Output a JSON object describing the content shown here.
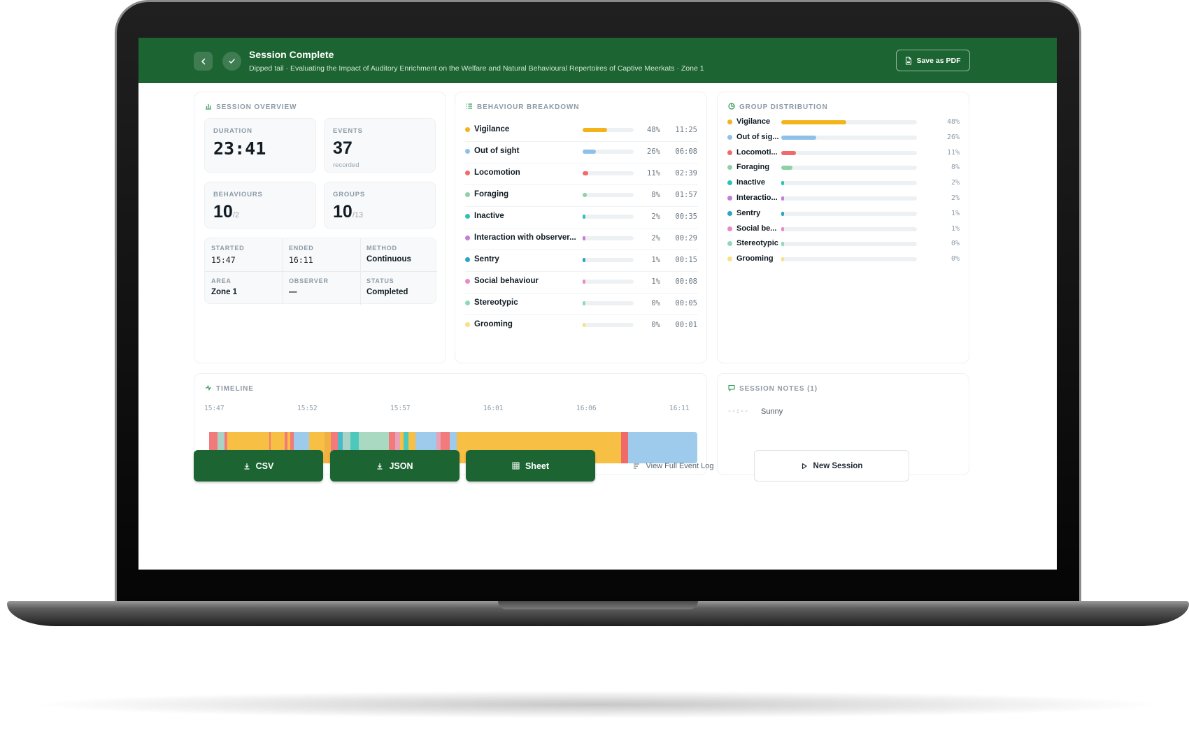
{
  "header": {
    "title": "Session Complete",
    "subtitle": "Dipped tail · Evaluating the Impact of Auditory Enrichment on the Welfare and Natural Behavioural Repertoires of Captive Meerkats · Zone 1",
    "save_pdf_label": "Save as PDF",
    "icons": {
      "back": "chevron-left-icon",
      "status": "check-icon",
      "pdf": "document-icon"
    }
  },
  "overview": {
    "title": "SESSION OVERVIEW",
    "duration": {
      "label": "DURATION",
      "value": "23:41"
    },
    "events": {
      "label": "EVENTS",
      "value": "37",
      "note": "recorded"
    },
    "behaviours": {
      "label": "BEHAVIOURS",
      "value": "10",
      "suffix": "/2"
    },
    "groups": {
      "label": "GROUPS",
      "value": "10",
      "suffix": "/13"
    },
    "meta": [
      {
        "label": "STARTED",
        "value": "15:47"
      },
      {
        "label": "ENDED",
        "value": "16:11"
      },
      {
        "label": "METHOD",
        "value": "Continuous"
      },
      {
        "label": "AREA",
        "value": "Zone 1"
      },
      {
        "label": "OBSERVER",
        "value": "—"
      },
      {
        "label": "STATUS",
        "value": "Completed"
      }
    ]
  },
  "breakdown": {
    "title": "BEHAVIOUR BREAKDOWN",
    "rows": [
      {
        "name": "Vigilance",
        "pct": "48%",
        "time": "11:25",
        "fraction": 0.48,
        "color": "#f3b41b"
      },
      {
        "name": "Out of sight",
        "pct": "26%",
        "time": "06:08",
        "fraction": 0.26,
        "color": "#8ec1ea"
      },
      {
        "name": "Locomotion",
        "pct": "11%",
        "time": "02:39",
        "fraction": 0.11,
        "color": "#f06a6a"
      },
      {
        "name": "Foraging",
        "pct": "8%",
        "time": "01:57",
        "fraction": 0.08,
        "color": "#8fd0a6"
      },
      {
        "name": "Inactive",
        "pct": "2%",
        "time": "00:35",
        "fraction": 0.02,
        "color": "#2cc3b6"
      },
      {
        "name": "Interaction with observer...",
        "pct": "2%",
        "time": "00:29",
        "fraction": 0.02,
        "color": "#c27fd4"
      },
      {
        "name": "Sentry",
        "pct": "1%",
        "time": "00:15",
        "fraction": 0.01,
        "color": "#2aa6c2"
      },
      {
        "name": "Social behaviour",
        "pct": "1%",
        "time": "00:08",
        "fraction": 0.01,
        "color": "#e98ac6"
      },
      {
        "name": "Stereotypic",
        "pct": "0%",
        "time": "00:05",
        "fraction": 0.0,
        "color": "#8fd9b8"
      },
      {
        "name": "Grooming",
        "pct": "0%",
        "time": "00:01",
        "fraction": 0.0,
        "color": "#f7e08a"
      }
    ]
  },
  "groups": {
    "title": "GROUP DISTRIBUTION",
    "rows": [
      {
        "name": "Vigilance",
        "pct": "48%",
        "fraction": 0.48,
        "color": "#f3b41b"
      },
      {
        "name": "Out of sig...",
        "pct": "26%",
        "fraction": 0.26,
        "color": "#8ec1ea"
      },
      {
        "name": "Locomoti...",
        "pct": "11%",
        "fraction": 0.11,
        "color": "#f06a6a"
      },
      {
        "name": "Foraging",
        "pct": "8%",
        "fraction": 0.08,
        "color": "#8fd0a6"
      },
      {
        "name": "Inactive",
        "pct": "2%",
        "fraction": 0.02,
        "color": "#2cc3b6"
      },
      {
        "name": "Interactio...",
        "pct": "2%",
        "fraction": 0.02,
        "color": "#c27fd4"
      },
      {
        "name": "Sentry",
        "pct": "1%",
        "fraction": 0.01,
        "color": "#2aa6c2"
      },
      {
        "name": "Social be...",
        "pct": "1%",
        "fraction": 0.01,
        "color": "#e98ac6"
      },
      {
        "name": "Stereotypic",
        "pct": "0%",
        "fraction": 0.0,
        "color": "#8fd9b8"
      },
      {
        "name": "Grooming",
        "pct": "0%",
        "fraction": 0.0,
        "color": "#f7e08a"
      }
    ]
  },
  "timeline": {
    "title": "TIMELINE",
    "ticks": [
      "15:47",
      "15:52",
      "15:57",
      "16:01",
      "16:06",
      "16:11"
    ],
    "segments": [
      {
        "start": 0.009,
        "end": 0.026,
        "color": "#f27a7a"
      },
      {
        "start": 0.026,
        "end": 0.04,
        "color": "#a9d3c5"
      },
      {
        "start": 0.04,
        "end": 0.046,
        "color": "#f27a7a"
      },
      {
        "start": 0.046,
        "end": 0.131,
        "color": "#f8bf45"
      },
      {
        "start": 0.131,
        "end": 0.134,
        "color": "#f27a7a"
      },
      {
        "start": 0.134,
        "end": 0.162,
        "color": "#f8bf45"
      },
      {
        "start": 0.162,
        "end": 0.168,
        "color": "#f27a7a"
      },
      {
        "start": 0.168,
        "end": 0.173,
        "color": "#f8bf45"
      },
      {
        "start": 0.173,
        "end": 0.18,
        "color": "#f27a7a"
      },
      {
        "start": 0.18,
        "end": 0.211,
        "color": "#9ecaec"
      },
      {
        "start": 0.211,
        "end": 0.243,
        "color": "#f8bf45"
      },
      {
        "start": 0.243,
        "end": 0.255,
        "color": "#f1b043"
      },
      {
        "start": 0.255,
        "end": 0.27,
        "color": "#f27a7a"
      },
      {
        "start": 0.27,
        "end": 0.28,
        "color": "#48b9c9"
      },
      {
        "start": 0.28,
        "end": 0.296,
        "color": "#a9d3c5"
      },
      {
        "start": 0.296,
        "end": 0.313,
        "color": "#4cc9bc"
      },
      {
        "start": 0.313,
        "end": 0.374,
        "color": "#a9d9c0"
      },
      {
        "start": 0.374,
        "end": 0.386,
        "color": "#f27a7a"
      },
      {
        "start": 0.386,
        "end": 0.397,
        "color": "#e7a2b9"
      },
      {
        "start": 0.397,
        "end": 0.404,
        "color": "#f8bf45"
      },
      {
        "start": 0.404,
        "end": 0.414,
        "color": "#4cc9bc"
      },
      {
        "start": 0.414,
        "end": 0.427,
        "color": "#f8bf45"
      },
      {
        "start": 0.427,
        "end": 0.47,
        "color": "#9ecaec"
      },
      {
        "start": 0.47,
        "end": 0.479,
        "color": "#e7a2b9"
      },
      {
        "start": 0.479,
        "end": 0.497,
        "color": "#f27a7a"
      },
      {
        "start": 0.497,
        "end": 0.511,
        "color": "#9ecaec"
      },
      {
        "start": 0.511,
        "end": 0.528,
        "color": "#f8bf45"
      },
      {
        "start": 0.528,
        "end": 0.845,
        "color": "#f8bf45"
      },
      {
        "start": 0.845,
        "end": 0.859,
        "color": "#f06a6a"
      },
      {
        "start": 0.859,
        "end": 1.0,
        "color": "#9ecaec"
      }
    ]
  },
  "notes": {
    "title": "SESSION NOTES (1)",
    "items": [
      {
        "time": "--:--",
        "text": "Sunny"
      }
    ]
  },
  "actions": {
    "csv": "CSV",
    "json": "JSON",
    "sheet": "Sheet",
    "event_log": "View Full Event Log",
    "new_session": "New Session"
  },
  "colors": {
    "brand": "#1c6431",
    "accent": "#2f9a53"
  }
}
